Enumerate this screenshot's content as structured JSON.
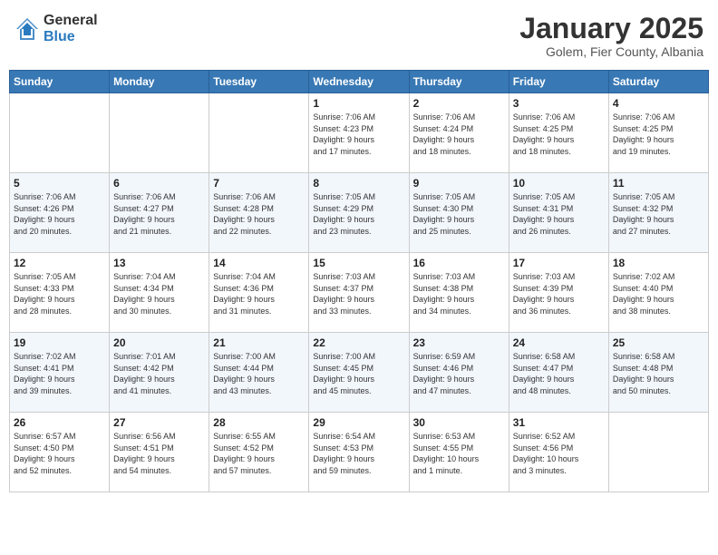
{
  "header": {
    "logo_general": "General",
    "logo_blue": "Blue",
    "month_title": "January 2025",
    "subtitle": "Golem, Fier County, Albania"
  },
  "weekdays": [
    "Sunday",
    "Monday",
    "Tuesday",
    "Wednesday",
    "Thursday",
    "Friday",
    "Saturday"
  ],
  "weeks": [
    [
      {
        "day": "",
        "info": ""
      },
      {
        "day": "",
        "info": ""
      },
      {
        "day": "",
        "info": ""
      },
      {
        "day": "1",
        "info": "Sunrise: 7:06 AM\nSunset: 4:23 PM\nDaylight: 9 hours\nand 17 minutes."
      },
      {
        "day": "2",
        "info": "Sunrise: 7:06 AM\nSunset: 4:24 PM\nDaylight: 9 hours\nand 18 minutes."
      },
      {
        "day": "3",
        "info": "Sunrise: 7:06 AM\nSunset: 4:25 PM\nDaylight: 9 hours\nand 18 minutes."
      },
      {
        "day": "4",
        "info": "Sunrise: 7:06 AM\nSunset: 4:25 PM\nDaylight: 9 hours\nand 19 minutes."
      }
    ],
    [
      {
        "day": "5",
        "info": "Sunrise: 7:06 AM\nSunset: 4:26 PM\nDaylight: 9 hours\nand 20 minutes."
      },
      {
        "day": "6",
        "info": "Sunrise: 7:06 AM\nSunset: 4:27 PM\nDaylight: 9 hours\nand 21 minutes."
      },
      {
        "day": "7",
        "info": "Sunrise: 7:06 AM\nSunset: 4:28 PM\nDaylight: 9 hours\nand 22 minutes."
      },
      {
        "day": "8",
        "info": "Sunrise: 7:05 AM\nSunset: 4:29 PM\nDaylight: 9 hours\nand 23 minutes."
      },
      {
        "day": "9",
        "info": "Sunrise: 7:05 AM\nSunset: 4:30 PM\nDaylight: 9 hours\nand 25 minutes."
      },
      {
        "day": "10",
        "info": "Sunrise: 7:05 AM\nSunset: 4:31 PM\nDaylight: 9 hours\nand 26 minutes."
      },
      {
        "day": "11",
        "info": "Sunrise: 7:05 AM\nSunset: 4:32 PM\nDaylight: 9 hours\nand 27 minutes."
      }
    ],
    [
      {
        "day": "12",
        "info": "Sunrise: 7:05 AM\nSunset: 4:33 PM\nDaylight: 9 hours\nand 28 minutes."
      },
      {
        "day": "13",
        "info": "Sunrise: 7:04 AM\nSunset: 4:34 PM\nDaylight: 9 hours\nand 30 minutes."
      },
      {
        "day": "14",
        "info": "Sunrise: 7:04 AM\nSunset: 4:36 PM\nDaylight: 9 hours\nand 31 minutes."
      },
      {
        "day": "15",
        "info": "Sunrise: 7:03 AM\nSunset: 4:37 PM\nDaylight: 9 hours\nand 33 minutes."
      },
      {
        "day": "16",
        "info": "Sunrise: 7:03 AM\nSunset: 4:38 PM\nDaylight: 9 hours\nand 34 minutes."
      },
      {
        "day": "17",
        "info": "Sunrise: 7:03 AM\nSunset: 4:39 PM\nDaylight: 9 hours\nand 36 minutes."
      },
      {
        "day": "18",
        "info": "Sunrise: 7:02 AM\nSunset: 4:40 PM\nDaylight: 9 hours\nand 38 minutes."
      }
    ],
    [
      {
        "day": "19",
        "info": "Sunrise: 7:02 AM\nSunset: 4:41 PM\nDaylight: 9 hours\nand 39 minutes."
      },
      {
        "day": "20",
        "info": "Sunrise: 7:01 AM\nSunset: 4:42 PM\nDaylight: 9 hours\nand 41 minutes."
      },
      {
        "day": "21",
        "info": "Sunrise: 7:00 AM\nSunset: 4:44 PM\nDaylight: 9 hours\nand 43 minutes."
      },
      {
        "day": "22",
        "info": "Sunrise: 7:00 AM\nSunset: 4:45 PM\nDaylight: 9 hours\nand 45 minutes."
      },
      {
        "day": "23",
        "info": "Sunrise: 6:59 AM\nSunset: 4:46 PM\nDaylight: 9 hours\nand 47 minutes."
      },
      {
        "day": "24",
        "info": "Sunrise: 6:58 AM\nSunset: 4:47 PM\nDaylight: 9 hours\nand 48 minutes."
      },
      {
        "day": "25",
        "info": "Sunrise: 6:58 AM\nSunset: 4:48 PM\nDaylight: 9 hours\nand 50 minutes."
      }
    ],
    [
      {
        "day": "26",
        "info": "Sunrise: 6:57 AM\nSunset: 4:50 PM\nDaylight: 9 hours\nand 52 minutes."
      },
      {
        "day": "27",
        "info": "Sunrise: 6:56 AM\nSunset: 4:51 PM\nDaylight: 9 hours\nand 54 minutes."
      },
      {
        "day": "28",
        "info": "Sunrise: 6:55 AM\nSunset: 4:52 PM\nDaylight: 9 hours\nand 57 minutes."
      },
      {
        "day": "29",
        "info": "Sunrise: 6:54 AM\nSunset: 4:53 PM\nDaylight: 9 hours\nand 59 minutes."
      },
      {
        "day": "30",
        "info": "Sunrise: 6:53 AM\nSunset: 4:55 PM\nDaylight: 10 hours\nand 1 minute."
      },
      {
        "day": "31",
        "info": "Sunrise: 6:52 AM\nSunset: 4:56 PM\nDaylight: 10 hours\nand 3 minutes."
      },
      {
        "day": "",
        "info": ""
      }
    ]
  ]
}
